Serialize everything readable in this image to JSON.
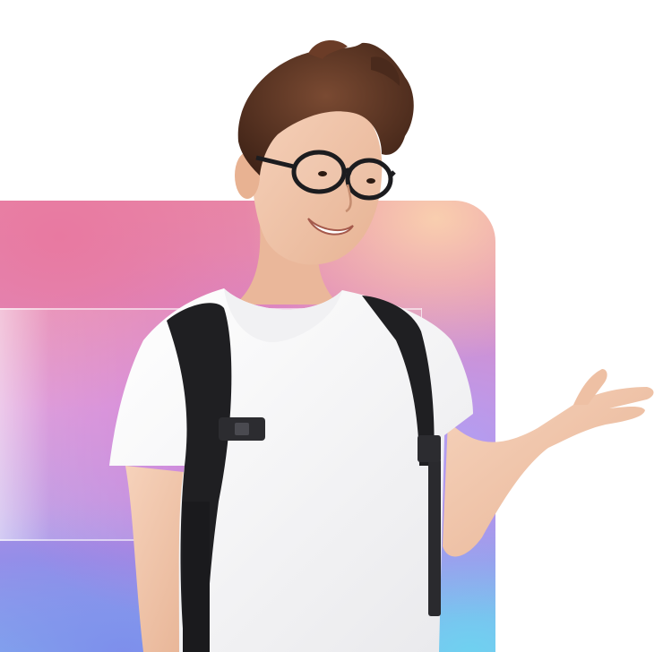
{
  "scene": {
    "subject": "person",
    "colors": {
      "page_background": "#ffffff",
      "tshirt": "#f7f7f7",
      "backpack_straps": "#1f1f22",
      "hair": "#5a3322",
      "skin": "#f2c9b0",
      "glasses": "#1c1c1f",
      "gradient_pink": "#e88aa8",
      "gradient_peach": "#fad2af",
      "gradient_violet": "#9c8fe8",
      "gradient_cyan": "#86d4f0"
    },
    "icons": [
      "backpack-buckle-icon"
    ]
  }
}
